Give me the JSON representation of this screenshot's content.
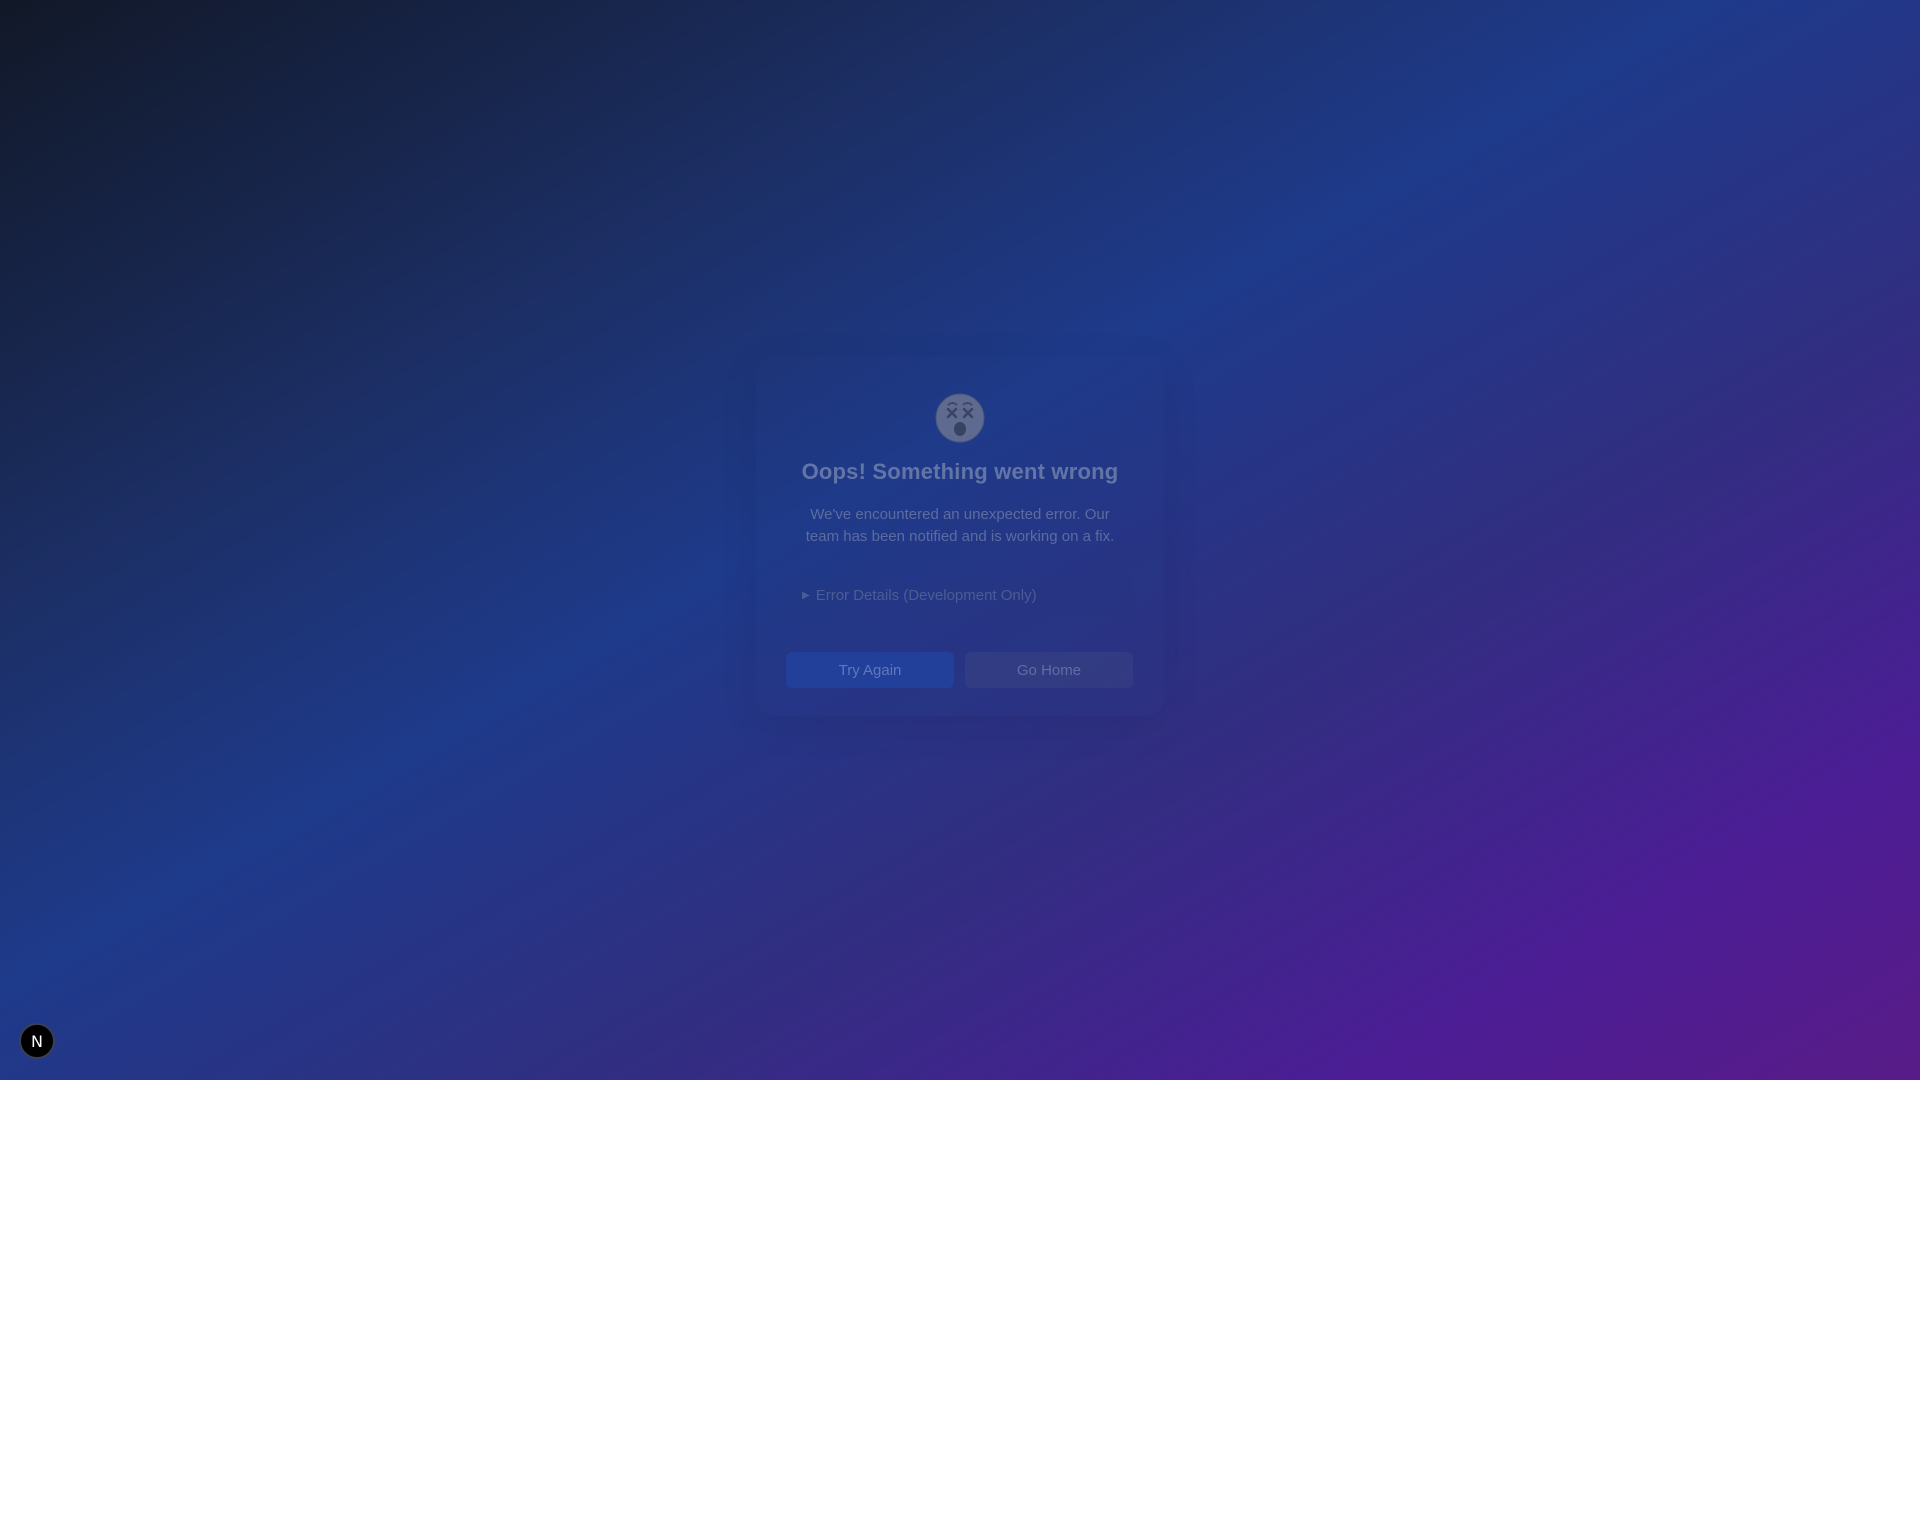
{
  "error_page": {
    "emoji_icon": "dizzy-face-icon",
    "title": "Oops! Something went wrong",
    "description": "We've encountered an unexpected error. Our team has been notified and is working on a fix.",
    "details_summary": "Error Details (Development Only)",
    "try_again_label": "Try Again",
    "go_home_label": "Go Home"
  },
  "dev_badge": {
    "icon": "nextjs-logo-icon",
    "letter": "N"
  },
  "colors": {
    "gradient_start": "#111827",
    "gradient_mid": "#1e3a8a",
    "gradient_end": "#581c87",
    "primary_button": "#22409a"
  }
}
